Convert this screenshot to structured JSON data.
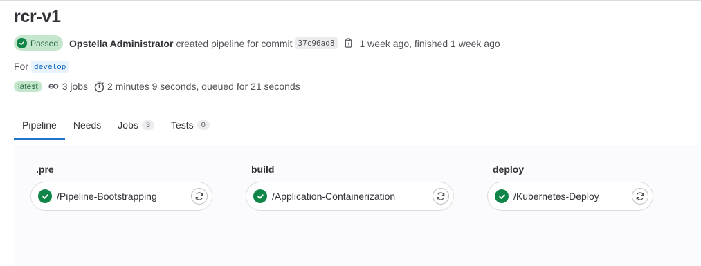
{
  "header": {
    "title": "rcr-v1",
    "status_badge": "Passed",
    "author": "Opstella Administrator",
    "action_text": "created pipeline for commit",
    "commit_sha": "37c96ad8",
    "time_text": "1 week ago, finished 1 week ago"
  },
  "branch": {
    "prefix": "For",
    "name": "develop"
  },
  "meta": {
    "latest_badge": "latest",
    "jobs_text": "3 jobs",
    "duration_text": "2 minutes 9 seconds, queued for 21 seconds"
  },
  "tabs": [
    {
      "label": "Pipeline",
      "count": ""
    },
    {
      "label": "Needs",
      "count": ""
    },
    {
      "label": "Jobs",
      "count": "3"
    },
    {
      "label": "Tests",
      "count": "0"
    }
  ],
  "stages": [
    {
      "name": ".pre",
      "job": "/Pipeline-Bootstrapping"
    },
    {
      "name": "build",
      "job": "/Application-Containerization"
    },
    {
      "name": "deploy",
      "job": "/Kubernetes-Deploy"
    }
  ],
  "colors": {
    "success": "#108548",
    "success_bg": "#c3e6cd",
    "tab_active": "#1f75cb",
    "branch_text": "#1068bf"
  }
}
